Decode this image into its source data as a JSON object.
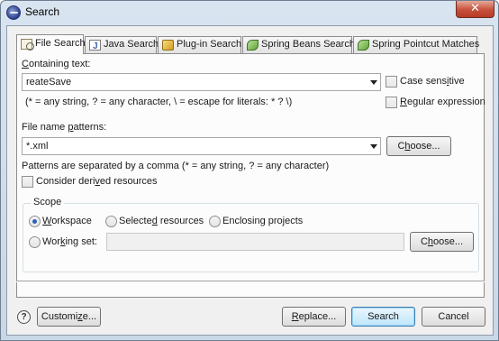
{
  "window": {
    "title": "Search",
    "close_glyph": "✕"
  },
  "tabs": [
    {
      "label": "File Search",
      "icon": "file-search-icon"
    },
    {
      "label": "Java Search",
      "icon": "java-search-icon"
    },
    {
      "label": "Plug-in Search",
      "icon": "plugin-search-icon"
    },
    {
      "label": "Spring Beans Search",
      "icon": "spring-beans-icon"
    },
    {
      "label": "Spring Pointcut Matches",
      "icon": "spring-pointcut-icon"
    }
  ],
  "containing_text": {
    "label_mnemonic": "C",
    "label_rest": "ontaining text:",
    "value": "reateSave",
    "hint": "(* = any string, ? = any character, \\ = escape for literals: * ? \\)"
  },
  "case_sensitive": {
    "label_pre": "Case sens",
    "label_mnemonic": "i",
    "label_post": "tive",
    "checked": false
  },
  "regular_expression": {
    "label_pre": "",
    "label_mnemonic": "R",
    "label_post": "egular expression",
    "checked": false
  },
  "file_name_patterns": {
    "label_pre": "File name ",
    "label_mnemonic": "p",
    "label_post": "atterns:",
    "value": "*.xml",
    "choose_pre": "C",
    "choose_mnemonic": "h",
    "choose_post": "oose...",
    "hint": "Patterns are separated by a comma (* = any string, ? = any character)"
  },
  "consider_derived": {
    "label_pre": "Consider deri",
    "label_mnemonic": "v",
    "label_post": "ed resources",
    "checked": false
  },
  "scope": {
    "title": "Scope",
    "workspace": {
      "label_pre": "",
      "label_mnemonic": "W",
      "label_post": "orkspace",
      "selected": true
    },
    "selected_resources": {
      "label_pre": "Selecte",
      "label_mnemonic": "d",
      "label_post": " resources",
      "selected": false
    },
    "enclosing_projects": {
      "label_pre": "Enclosing pro",
      "label_mnemonic": "j",
      "label_post": "ects",
      "selected": false
    },
    "working_set": {
      "label_pre": "Wor",
      "label_mnemonic": "k",
      "label_post": "ing set:",
      "selected": false,
      "value": ""
    },
    "choose_pre": "C",
    "choose_mnemonic": "h",
    "choose_post": "oose..."
  },
  "footer": {
    "help_glyph": "?",
    "customize_pre": "Customi",
    "customize_mnemonic": "z",
    "customize_post": "e...",
    "replace_pre": "",
    "replace_mnemonic": "R",
    "replace_post": "eplace...",
    "search_label": "Search",
    "cancel_label": "Cancel"
  }
}
